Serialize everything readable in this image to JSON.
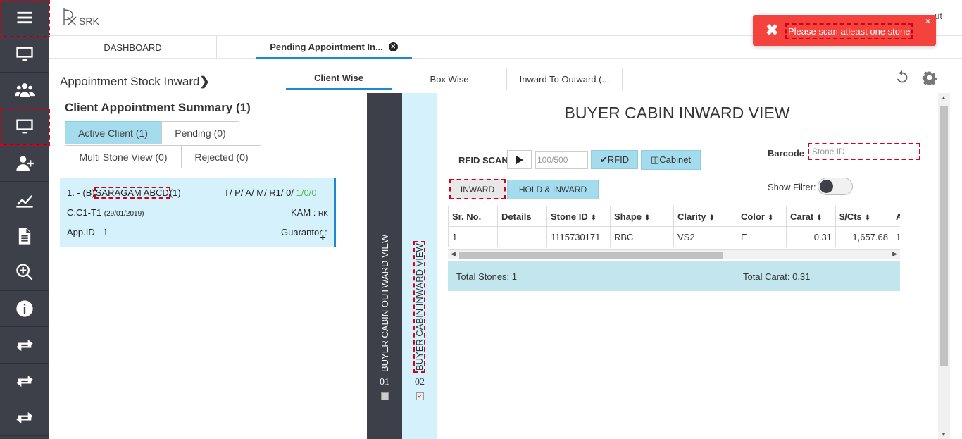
{
  "sidebar": {
    "items": [
      {
        "icon": "menu-icon"
      },
      {
        "icon": "monitor-icon"
      },
      {
        "icon": "users-icon"
      },
      {
        "icon": "monitor-icon"
      },
      {
        "icon": "add-user-icon"
      },
      {
        "icon": "chart-icon"
      },
      {
        "icon": "document-icon"
      },
      {
        "icon": "zoom-in-icon"
      },
      {
        "icon": "info-icon"
      },
      {
        "icon": "transfer-icon"
      },
      {
        "icon": "transfer-icon"
      },
      {
        "icon": "transfer-icon"
      }
    ]
  },
  "header": {
    "logo_text": "SRK",
    "right_text": "ut"
  },
  "tabs": {
    "dashboard": "DASHBOARD",
    "pending": "Pending Appointment In...",
    "close_glyph": "✕"
  },
  "toast": {
    "icon": "✖",
    "message": "Please scan atleast one stone",
    "close": "×",
    "color": "#f4423c"
  },
  "page": {
    "title": "Appointment Stock Inward",
    "title_chevron": "❯",
    "subtabs": {
      "client_wise": "Client Wise",
      "box_wise": "Box Wise",
      "inward_to_outward": "Inward To Outward (..."
    }
  },
  "left": {
    "summary_title": "Client Appointment Summary (1)",
    "filters": {
      "active": "Active Client (1)",
      "pending": "Pending (0)",
      "multi": "Multi Stone View (0)",
      "rejected": "Rejected (0)"
    },
    "client": {
      "prefix": "1. - (B)",
      "name": "SARAGAM ABCD",
      "count": "(1)",
      "stats_prefix": "T/ P/ A/ M/ R1/ 0/",
      "stats_green1": "1/",
      "stats_green2": "0/",
      "stats_green3": "0",
      "code": "C:C1-T1",
      "date": "(29/01/2019)",
      "kam_label": "KAM :",
      "kam_value": "RK",
      "app_id": "App.ID - 1",
      "guarantor": "Guarantor :",
      "plus": "+"
    }
  },
  "vtabs": {
    "outward": {
      "label": "BUYER CABIN OUTWARD VIEW",
      "num": "01"
    },
    "inward": {
      "label": "BUYER CABIN INWARD VIEW",
      "num": "02",
      "check": "✔"
    }
  },
  "main": {
    "title": "BUYER CABIN INWARD VIEW",
    "rfid_label": "RFID SCAN",
    "rfid_count_placeholder": "100/500",
    "rfid_btn": "✔RFID",
    "cabinet_btn": "◫Cabinet",
    "barcode_label": "Barcode",
    "stone_placeholder": "Stone ID",
    "inward_btn": "INWARD",
    "hold_btn": "HOLD & INWARD",
    "filter_label": "Show Filter:",
    "table": {
      "headers": [
        "Sr. No.",
        "Details",
        "Stone ID",
        "Shape",
        "Clarity",
        "Color",
        "Carat",
        "$/Cts",
        "Ap"
      ],
      "sortable": [
        false,
        false,
        true,
        true,
        true,
        true,
        true,
        true,
        false
      ],
      "rows": [
        [
          "1",
          "",
          "1115730171",
          "RBC",
          "VS2",
          "E",
          "0.31",
          "1,657.68",
          "1"
        ]
      ]
    },
    "totals": {
      "stones": "Total Stones: 1",
      "carat": "Total Carat: 0.31"
    }
  }
}
